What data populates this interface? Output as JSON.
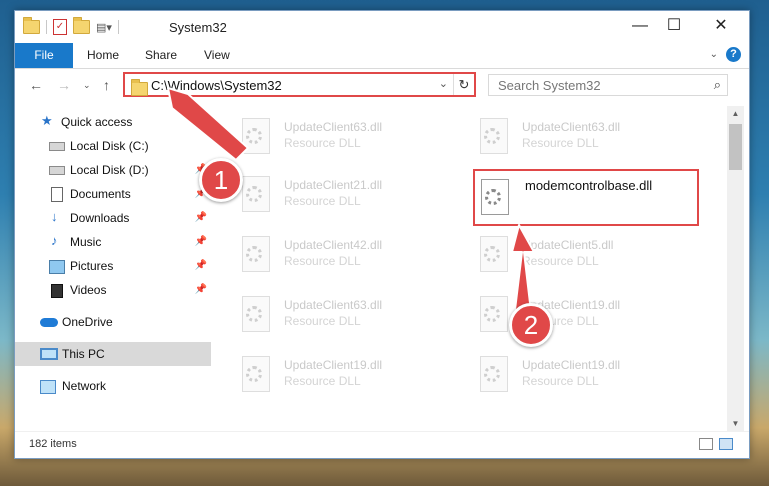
{
  "window": {
    "title": "System32"
  },
  "ribbon": {
    "tabs": [
      "File",
      "Home",
      "Share",
      "View"
    ]
  },
  "address": {
    "path": "C:\\Windows\\System32"
  },
  "search": {
    "placeholder": "Search System32"
  },
  "sidebar": {
    "items": [
      {
        "label": "Quick access",
        "icon": "star-icon"
      },
      {
        "label": "Local Disk (C:)",
        "icon": "disk-icon"
      },
      {
        "label": "Local Disk (D:)",
        "icon": "disk-icon"
      },
      {
        "label": "Documents",
        "icon": "documents-icon"
      },
      {
        "label": "Downloads",
        "icon": "downloads-icon"
      },
      {
        "label": "Music",
        "icon": "music-icon"
      },
      {
        "label": "Pictures",
        "icon": "pictures-icon"
      },
      {
        "label": "Videos",
        "icon": "videos-icon"
      },
      {
        "label": "OneDrive",
        "icon": "onedrive-icon"
      },
      {
        "label": "This PC",
        "icon": "pc-icon"
      },
      {
        "label": "Network",
        "icon": "network-icon"
      }
    ]
  },
  "files": [
    {
      "name": "UpdateClient63.dll",
      "type": "Resource DLL"
    },
    {
      "name": "UpdateClient63.dll",
      "type": "Resource DLL"
    },
    {
      "name": "UpdateClient21.dll",
      "type": "Resource DLL"
    },
    {
      "name": "modemcontrolbase.dll",
      "type": ""
    },
    {
      "name": "UpdateClient42.dll",
      "type": "Resource DLL"
    },
    {
      "name": "UpdateClient5.dll",
      "type": "Resource DLL"
    },
    {
      "name": "UpdateClient63.dll",
      "type": "Resource DLL"
    },
    {
      "name": "UpdateClient19.dll",
      "type": "Resource DLL"
    },
    {
      "name": "UpdateClient19.dll",
      "type": "Resource DLL"
    },
    {
      "name": "UpdateClient19.dll",
      "type": "Resource DLL"
    }
  ],
  "status": {
    "items_count": "182 items"
  },
  "callouts": {
    "one": "1",
    "two": "2"
  },
  "colors": {
    "accent": "#1979ca",
    "highlight": "#e04848"
  }
}
